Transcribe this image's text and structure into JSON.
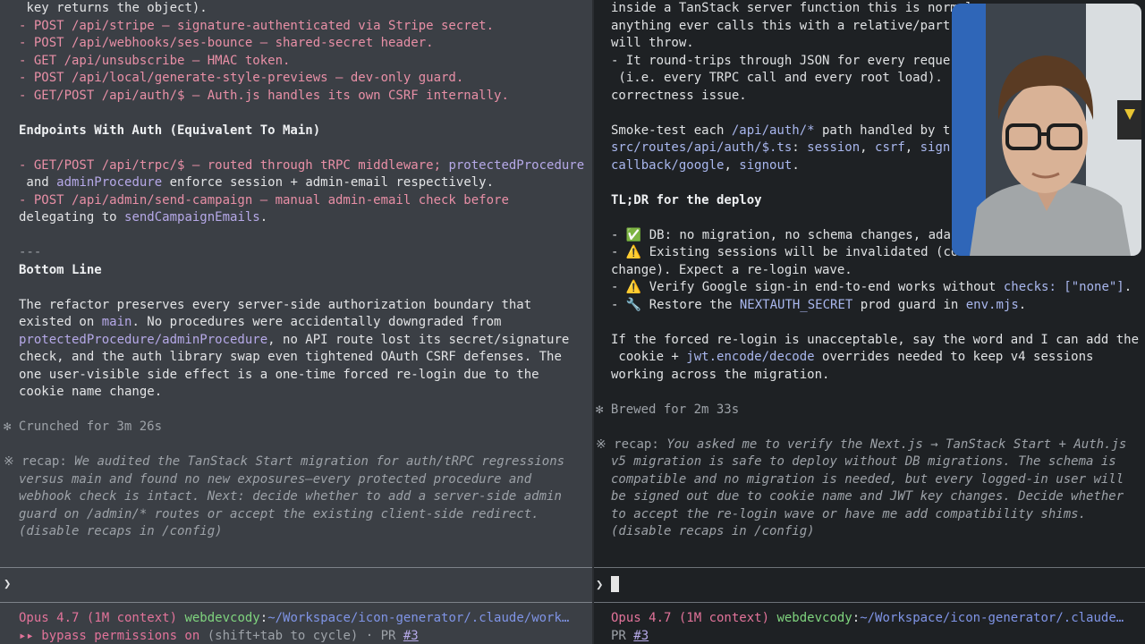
{
  "left_pane": {
    "lines": [
      "key returns the object).",
      "- POST /api/stripe – signature-authenticated via Stripe secret.",
      "- POST /api/webhooks/ses-bounce – shared-secret header.",
      "- GET /api/unsubscribe – HMAC token.",
      "- POST /api/local/generate-style-previews – dev-only guard.",
      "- GET/POST /api/auth/$ – Auth.js handles its own CSRF internally.",
      "Endpoints With Auth (Equivalent To Main)",
      "- GET/POST /api/trpc/$ – routed through tRPC middleware; ",
      "protectedProcedure",
      " and ",
      "adminProcedure",
      " enforce session + admin-email respectively.",
      "- POST /api/admin/send-campaign – manual admin-email check before",
      "delegating to ",
      "sendCampaignEmails",
      ".",
      "---",
      "Bottom Line",
      "The refactor preserves every server-side authorization boundary that",
      "existed on ",
      "main",
      ". No procedures were accidentally downgraded from",
      "protectedProcedure/adminProcedure",
      ", no API route lost its secret/signature",
      "check, and the auth library swap even tightened OAuth CSRF defenses. The",
      "one user-visible side effect is a one-time forced re-login due to the",
      "cookie name change.",
      "✻ Crunched for 3m 26s",
      "※ ",
      "recap: ",
      "We audited the TanStack Start migration for auth/tRPC regressions",
      "versus main and found no new exposures—every protected procedure and",
      "webhook check is intact. Next: decide whether to add a server-side admin",
      "guard on /admin/* routes or accept the existing client-side redirect.",
      "(disable recaps in /config)"
    ],
    "prompt_symbol": "❯",
    "status": {
      "model": "Opus 4.7 (1M context)",
      "host": "webdevcody",
      "colon": ":",
      "path": "~/Workspace/icon-generator/.claude/work…",
      "bypass": "▸▸ bypass permissions on",
      "cycle": " (shift+tab to cycle) · PR ",
      "pr": "#3"
    }
  },
  "right_pane": {
    "lines": [
      "inside a TanStack server function this is normal",
      "anything ever calls this with a relative/part",
      "will throw.",
      "- It round-trips through JSON for every reque",
      " (i.e. every TRPC call and every root load).",
      "correctness issue.",
      "Smoke-test each ",
      "/api/auth/*",
      " path handled by t",
      "src/routes/api/auth/$.ts",
      ": ",
      "session",
      ", ",
      "csrf",
      ", ",
      "sign",
      "callback/google",
      ", ",
      "signout",
      ".",
      "TL;DR for the deploy",
      "- ✅ DB: no migration, no schema changes, ada",
      "- ⚠️ Existing sessions will be invalidated (co",
      "change). Expect a re-login wave.",
      "- ⚠️ Verify Google sign-in end-to-end works without ",
      "checks: [\"none\"]",
      ".",
      "- 🔧 Restore the ",
      "NEXTAUTH_SECRET",
      " prod guard in ",
      "env.mjs",
      ".",
      "If the forced re-login is unacceptable, say the word and I can add the",
      " cookie + ",
      "jwt.encode/decode",
      " overrides needed to keep v4 sessions",
      "working across the migration.",
      "✻ Brewed for 2m 33s",
      "※ ",
      "recap: ",
      "You asked me to verify the Next.js → TanStack Start + Auth.js",
      "v5 migration ",
      "is",
      " safe to deploy without DB migrations. The schema is",
      "compatible and no migration is needed, but every logged-in user will",
      "be signed out due to cookie name and JWT key changes. Decide whether",
      "to accept the re-login wave or have me add compatibility shims.",
      "(disable recaps in /config)"
    ],
    "prompt_symbol": "❯",
    "status": {
      "model": "Opus 4.7 (1M context)",
      "host": "webdevcody",
      "colon": ":",
      "path": "~/Workspace/icon-generator/.claude…",
      "pr_label": "PR ",
      "pr": "#3"
    }
  }
}
